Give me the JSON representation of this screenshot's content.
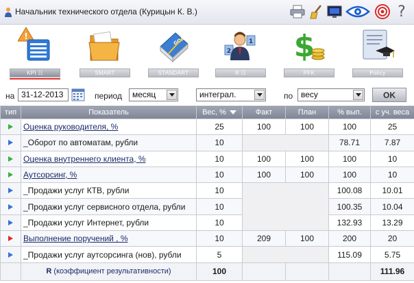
{
  "header": {
    "title": "Начальник технического отдела  (Курицын К. В.)",
    "tools": [
      "printer-icon",
      "broom-icon",
      "display-icon",
      "eye-icon",
      "target-icon",
      "help-icon"
    ],
    "help_glyph": "?"
  },
  "nav": {
    "items": [
      {
        "label": "KPI ☷",
        "icon": "kpi-warning-icon",
        "active": true
      },
      {
        "label": "SMART",
        "icon": "folder-icon",
        "active": false
      },
      {
        "label": "STANDART",
        "icon": "goal-book-icon",
        "active": false
      },
      {
        "label": "R ☷",
        "icon": "user-ranking-icon",
        "active": false
      },
      {
        "label": "PFK",
        "icon": "money-icon",
        "active": false
      },
      {
        "label": "Policy",
        "icon": "policy-scroll-icon",
        "active": false
      }
    ]
  },
  "filter": {
    "date_label": "на",
    "date_value": "31-12-2013",
    "period_label": "период",
    "period_value": "месяц",
    "mode_value": "интеграл.",
    "by_label": "по",
    "by_value": "весу",
    "ok_label": "OK"
  },
  "table": {
    "headers": {
      "type": "тип",
      "name": "Показатель",
      "weight": "Вес, %",
      "fact": "Факт",
      "plan": "План",
      "pct": "% вып.",
      "weighted": "с уч. веса"
    },
    "rows": [
      {
        "type": "green",
        "name": "Оценка руководителя, %",
        "link": true,
        "weight": "25",
        "fact": "100",
        "plan": "100",
        "pct": "100",
        "weighted": "25",
        "gray": false
      },
      {
        "type": "blue",
        "name": "_Оборот по автоматам, рубли",
        "link": false,
        "weight": "10",
        "fact": "",
        "plan": "",
        "pct": "78.71",
        "weighted": "7.87",
        "gray": true
      },
      {
        "type": "green",
        "name": "Оценка внутреннего клиента, %",
        "link": true,
        "weight": "10",
        "fact": "100",
        "plan": "100",
        "pct": "100",
        "weighted": "10",
        "gray": false
      },
      {
        "type": "green",
        "name": "Аутсорсинг, %",
        "link": true,
        "weight": "10",
        "fact": "100",
        "plan": "100",
        "pct": "100",
        "weighted": "10",
        "gray": false
      },
      {
        "type": "blue",
        "name": "_Продажи услуг КТВ, рубли",
        "link": false,
        "weight": "10",
        "fact": "",
        "plan": "",
        "pct": "100.08",
        "weighted": "10.01",
        "gray": true
      },
      {
        "type": "blue",
        "name": "_Продажи услуг сервисного отдела, рубли",
        "link": false,
        "weight": "10",
        "fact": "",
        "plan": "",
        "pct": "100.35",
        "weighted": "10.04",
        "gray": true
      },
      {
        "type": "blue",
        "name": "_Продажи услуг Интернет, рубли",
        "link": false,
        "weight": "10",
        "fact": "",
        "plan": "",
        "pct": "132.93",
        "weighted": "13.29",
        "gray": true
      },
      {
        "type": "red",
        "name": "Выполнение поручений , %",
        "link": true,
        "weight": "10",
        "fact": "209",
        "plan": "100",
        "pct": "200",
        "weighted": "20",
        "gray": false
      },
      {
        "type": "blue",
        "name": "_Продажи услуг аутсорсинга (нов), рубли",
        "link": false,
        "weight": "5",
        "fact": "",
        "plan": "",
        "pct": "115.09",
        "weighted": "5.75",
        "gray": true
      }
    ],
    "footer": {
      "label_bold": "R",
      "label_rest": " (коэффициент результативности)",
      "weight_total": "100",
      "weighted_total": "111.96"
    }
  }
}
